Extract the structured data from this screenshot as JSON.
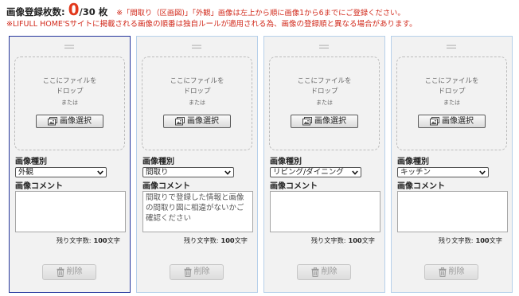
{
  "colors": {
    "accent": "#e2381b",
    "note": "#d22b1d",
    "selected_border": "#23349c",
    "card_border": "#b6d0ea"
  },
  "icons": {
    "handle": "drag-handle-icon",
    "image": "image-icon",
    "chevron": "chevron-down-icon",
    "trash": "trash-icon"
  },
  "header": {
    "count_label": "画像登録枚数:",
    "count_value": "0",
    "count_total": "/30",
    "count_unit": "枚",
    "note1": "※「間取り（区画図)」「外観」画像は左上から順に画像1から6までにご登録ください。",
    "note2": "※LIFULL HOME'Sサイトに掲載される画像の順番は独自ルールが適用される為、画像の登録順と異なる場合があります。"
  },
  "cards": [
    {
      "selected": true,
      "drop_line1": "ここにファイルを",
      "drop_line2": "ドロップ",
      "or_text": "または",
      "select_image_button": "画像選択",
      "image_type_label": "画像種別",
      "image_type_value": "外観",
      "comment_label": "画像コメント",
      "comment_value": "",
      "remaining_label": "残り文字数:",
      "remaining_count": "100",
      "remaining_unit": "文字",
      "delete_button": "削除"
    },
    {
      "selected": false,
      "drop_line1": "ここにファイルを",
      "drop_line2": "ドロップ",
      "or_text": "または",
      "select_image_button": "画像選択",
      "image_type_label": "画像種別",
      "image_type_value": "間取り",
      "comment_label": "画像コメント",
      "comment_value": "間取りで登録した情報と画像の間取り図に相違がないかご確認ください",
      "remaining_label": "残り文字数:",
      "remaining_count": "100",
      "remaining_unit": "文字",
      "delete_button": "削除"
    },
    {
      "selected": false,
      "drop_line1": "ここにファイルを",
      "drop_line2": "ドロップ",
      "or_text": "または",
      "select_image_button": "画像選択",
      "image_type_label": "画像種別",
      "image_type_value": "リビング/ダイニング",
      "comment_label": "画像コメント",
      "comment_value": "",
      "remaining_label": "残り文字数:",
      "remaining_count": "100",
      "remaining_unit": "文字",
      "delete_button": "削除"
    },
    {
      "selected": false,
      "drop_line1": "ここにファイルを",
      "drop_line2": "ドロップ",
      "or_text": "または",
      "select_image_button": "画像選択",
      "image_type_label": "画像種別",
      "image_type_value": "キッチン",
      "comment_label": "画像コメント",
      "comment_value": "",
      "remaining_label": "残り文字数:",
      "remaining_count": "100",
      "remaining_unit": "文字",
      "delete_button": "削除"
    }
  ]
}
